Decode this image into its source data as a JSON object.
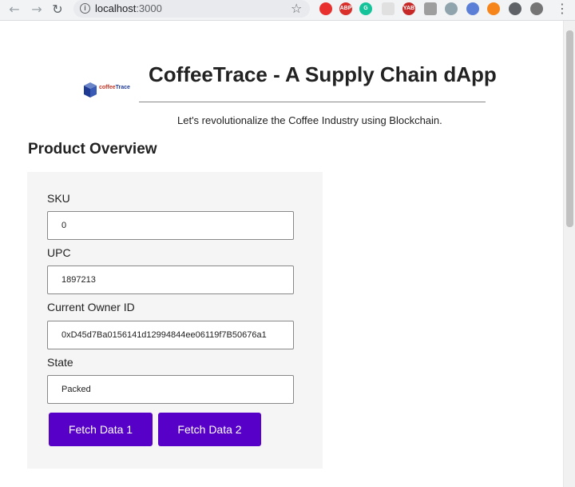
{
  "browser": {
    "url_host": "localhost",
    "url_port": ":3000"
  },
  "header": {
    "logo_text_part1": "coffee",
    "logo_text_part2": "Trace",
    "title": "CoffeeTrace - A Supply Chain dApp",
    "tagline": "Let's revolutionalize the Coffee Industry using Blockchain."
  },
  "product_overview": {
    "section_title": "Product Overview",
    "fields": [
      {
        "label": "SKU",
        "value": "0"
      },
      {
        "label": "UPC",
        "value": "1897213"
      },
      {
        "label": "Current Owner ID",
        "value": "0xD45d7Ba0156141d12994844ee06119f7B50676a1"
      },
      {
        "label": "State",
        "value": "Packed"
      }
    ],
    "buttons": {
      "fetch1": "Fetch Data 1",
      "fetch2": "Fetch Data 2"
    }
  },
  "colors": {
    "button_bg": "#5600c8",
    "panel_bg": "#f5f5f5"
  }
}
